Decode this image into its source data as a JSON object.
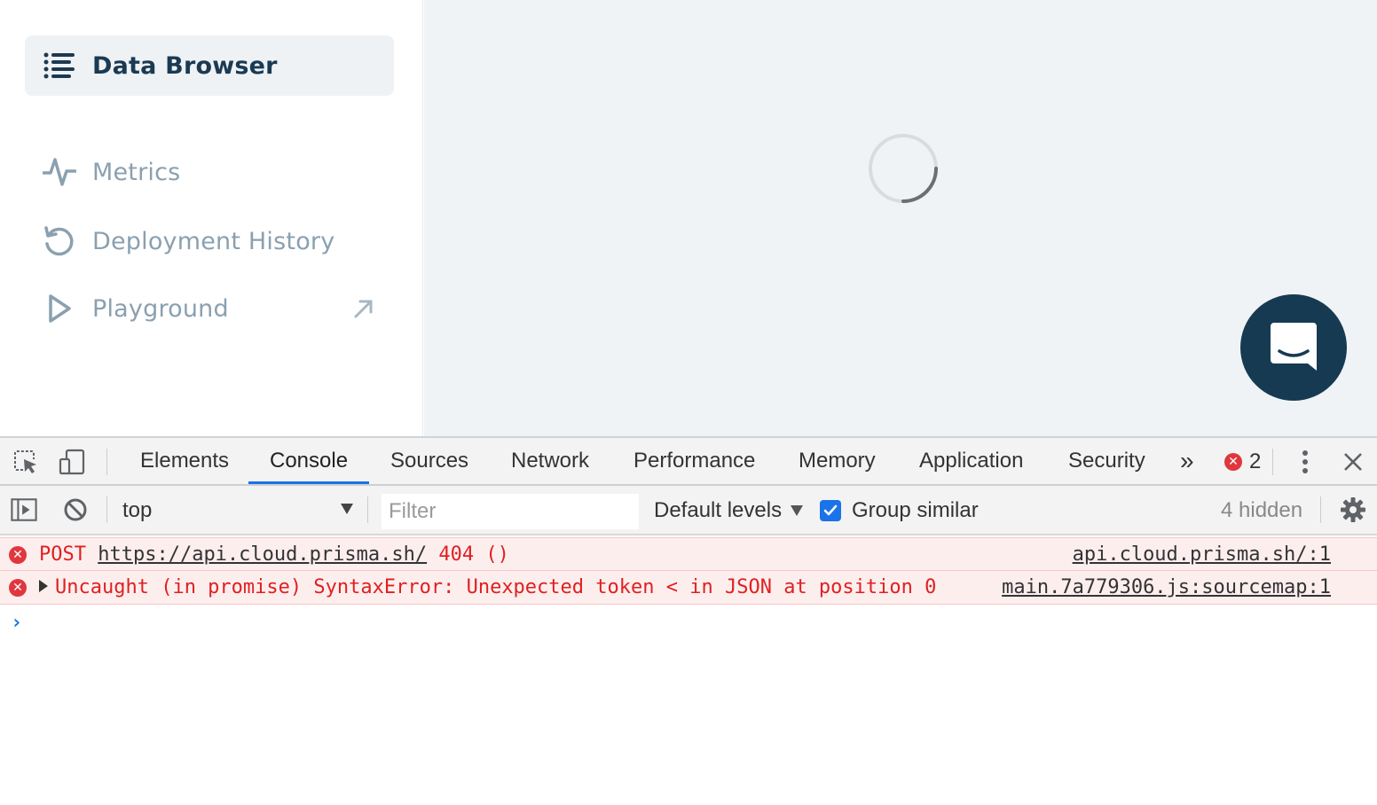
{
  "sidebar": {
    "items": [
      {
        "label": "Data Browser",
        "icon": "list-icon",
        "active": true
      },
      {
        "label": "Metrics",
        "icon": "activity-icon",
        "active": false
      },
      {
        "label": "Deployment History",
        "icon": "history-icon",
        "active": false
      },
      {
        "label": "Playground",
        "icon": "play-icon",
        "active": false,
        "external": true
      }
    ]
  },
  "content": {
    "loading": true,
    "chat_icon": "chat-bubble-icon"
  },
  "devtools": {
    "tabs": [
      "Elements",
      "Console",
      "Sources",
      "Network",
      "Performance",
      "Memory",
      "Application",
      "Security"
    ],
    "active_tab": "Console",
    "overflow_label": "»",
    "error_count": "2",
    "console": {
      "context": "top",
      "filter_placeholder": "Filter",
      "levels_label": "Default levels",
      "group_similar_label": "Group similar",
      "group_similar_checked": true,
      "hidden_label": "4 hidden"
    },
    "messages": [
      {
        "prefix": "POST ",
        "link": "https://api.cloud.prisma.sh/",
        "suffix": " 404 ()",
        "source": "api.cloud.prisma.sh/:1",
        "expandable": false
      },
      {
        "prefix": "Uncaught (in promise) SyntaxError: Unexpected token < in JSON at position 0",
        "link": "",
        "suffix": "",
        "source": "main.7a779306.js:sourcemap:1",
        "expandable": true
      }
    ],
    "prompt": "›"
  },
  "colors": {
    "brand_dark": "#163a52",
    "sidebar_active_bg": "#eef2f5",
    "nav_inactive": "#8aa0b0",
    "error_red": "#e02020",
    "devtools_accent": "#1a73e8"
  }
}
